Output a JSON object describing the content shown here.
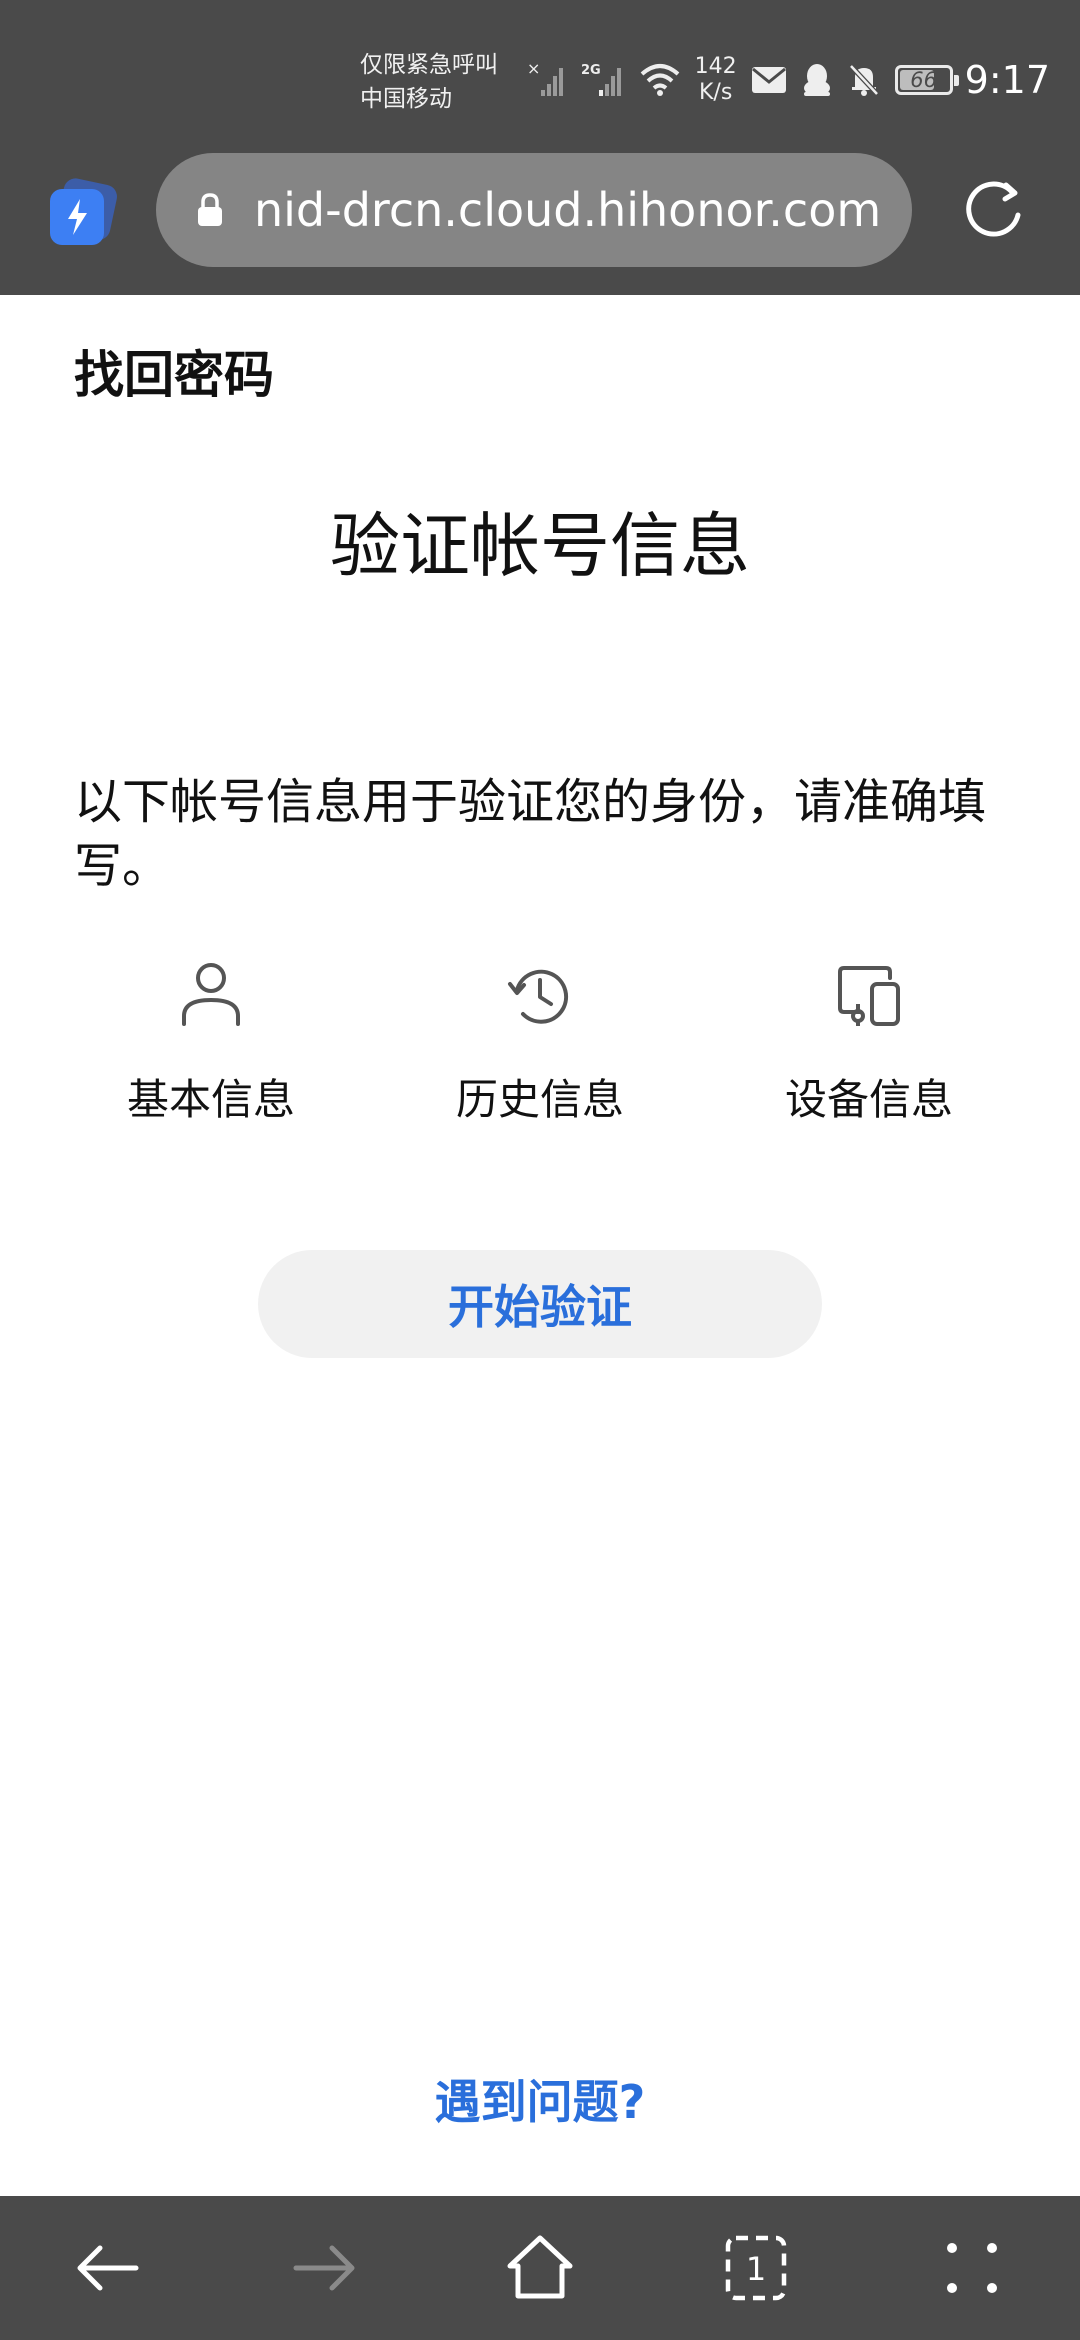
{
  "status_bar": {
    "carrier_line1": "仅限紧急呼叫",
    "carrier_line2": "中国移动",
    "network_type": "2G",
    "speed_value": "142",
    "speed_unit": "K/s",
    "battery_level": "66",
    "time": "9:17"
  },
  "browser": {
    "url": "nid-drcn.cloud.hihonor.com",
    "tab_count": "1"
  },
  "page": {
    "header": "找回密码",
    "title": "验证帐号信息",
    "description": "以下帐号信息用于验证您的身份，请准确填写。",
    "features": [
      {
        "label": "基本信息",
        "icon": "person-icon"
      },
      {
        "label": "历史信息",
        "icon": "history-clock-icon"
      },
      {
        "label": "设备信息",
        "icon": "devices-icon"
      }
    ],
    "start_button": "开始验证",
    "help_link": "遇到问题?"
  },
  "colors": {
    "accent": "#2a6fdb",
    "chrome": "#4a4a4a"
  }
}
